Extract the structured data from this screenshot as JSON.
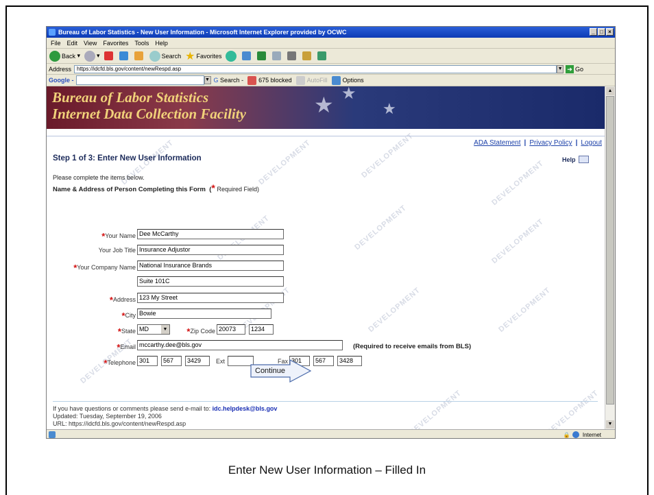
{
  "browser": {
    "title": "Bureau of Labor Statistics - New User Information - Microsoft Internet Explorer provided by OCWC",
    "menu": [
      "File",
      "Edit",
      "View",
      "Favorites",
      "Tools",
      "Help"
    ],
    "toolbar": {
      "back": "Back",
      "search": "Search",
      "favorites": "Favorites"
    },
    "address_label": "Address",
    "address": "https://idcfd.bls.gov/content/newRespd.asp",
    "go": "Go",
    "google": {
      "logo": "Google -",
      "search": "Search",
      "blocked": "675 blocked",
      "autofill": "AutoFill",
      "options": "Options"
    },
    "status_zone": "Internet"
  },
  "banner": {
    "line1": "Bureau of Labor Statistics",
    "line2": "Internet Data Collection Facility"
  },
  "links": [
    "ADA Statement",
    "Privacy Policy",
    "Logout"
  ],
  "page": {
    "step_title": "Step 1 of 3: Enter New User Information",
    "help": "Help",
    "intro": "Please complete the items below.",
    "section": "Name & Address of Person Completing this Form",
    "required_note": "Required Field)",
    "required_open": "(",
    "required_star": "*",
    "watermark": "DEVELOPMENT"
  },
  "form": {
    "your_name": {
      "label": "Your Name",
      "value": "Dee McCarthy"
    },
    "job_title": {
      "label": "Your Job Title",
      "value": "Insurance Adjustor"
    },
    "company": {
      "label": "Your Company Name",
      "value": "National Insurance Brands"
    },
    "company2": {
      "value": "Suite 101C"
    },
    "address": {
      "label": "Address",
      "value": "123 My Street"
    },
    "city": {
      "label": "City",
      "value": "Bowie"
    },
    "state": {
      "label": "State",
      "value": "MD"
    },
    "zip": {
      "label": "Zip Code",
      "value": "20073",
      "ext": "1234"
    },
    "email": {
      "label": "Email",
      "value": "mccarthy.dee@bls.gov",
      "note": "(Required to receive emails from BLS)"
    },
    "telephone": {
      "label": "Telephone",
      "area": "301",
      "prefix": "567",
      "line": "3429",
      "ext_label": "Ext",
      "ext": ""
    },
    "fax": {
      "label": "Fax",
      "area": "301",
      "prefix": "567",
      "line": "3428"
    },
    "continue": "Continue"
  },
  "footer": {
    "question": "If you have questions or comments please send e-mail to:",
    "email": "idc.helpdesk@bls.gov",
    "updated": "Updated: Tuesday, September 19, 2006",
    "url": "URL: https://idcfd.bls.gov/content/newRespd.asp"
  },
  "caption": "Enter New User Information – Filled In"
}
